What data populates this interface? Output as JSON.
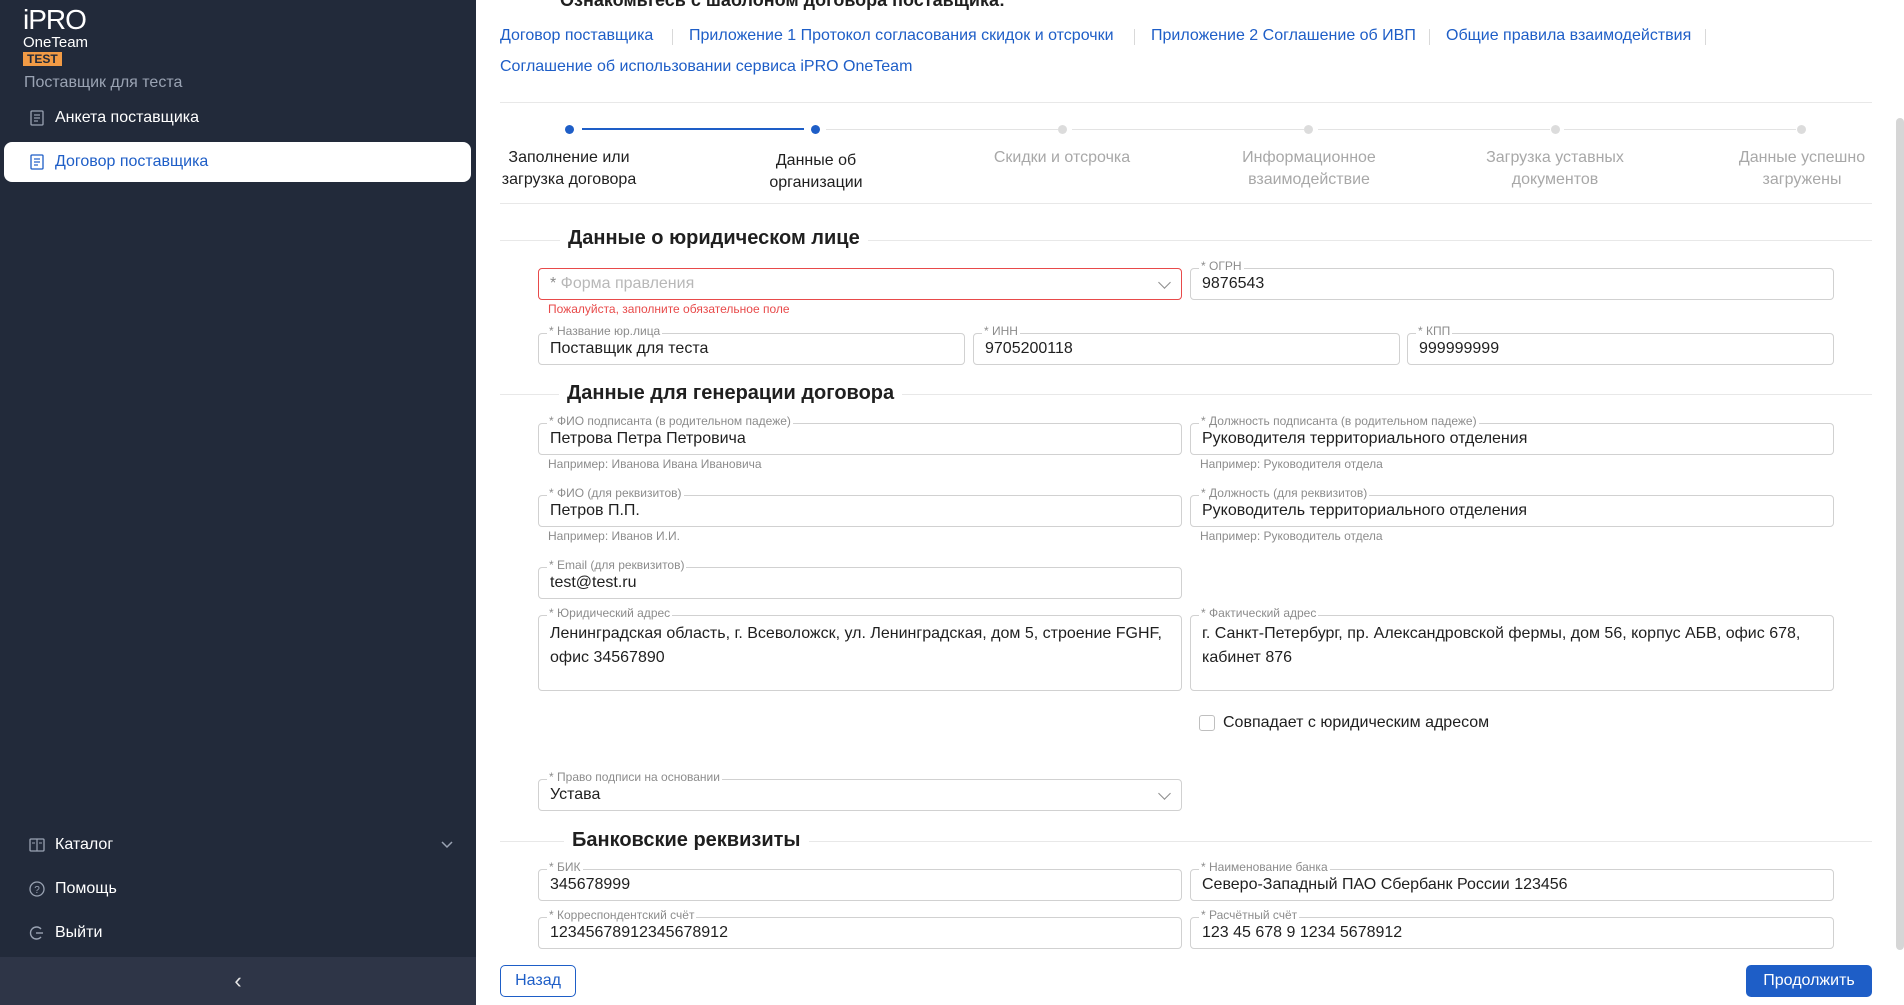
{
  "sidebar": {
    "logo_line1": "iPRO",
    "logo_line2": "OneTeam",
    "logo_badge": "TEST",
    "company": "Поставщик для теста",
    "items": [
      {
        "label": "Анкета поставщика",
        "icon": "document-icon"
      },
      {
        "label": "Договор поставщика",
        "icon": "document-icon",
        "active": true
      }
    ],
    "bottom_items": [
      {
        "label": "Каталог",
        "icon": "catalog-icon"
      },
      {
        "label": "Помощь",
        "icon": "help-icon"
      },
      {
        "label": "Выйти",
        "icon": "logout-icon"
      }
    ],
    "collapse_glyph": "‹"
  },
  "header": {
    "cut_title": "Ознакомьтесь с шаблоном договора поставщика:",
    "links": [
      "Договор поставщика",
      "Приложение 1 Протокол согласования скидок и отсрочки",
      "Приложение 2 Соглашение об ИВП",
      "Общие правила взаимодействия",
      "Соглашение об использовании сервиса iPRO OneTeam"
    ]
  },
  "steps": [
    {
      "label_1": "Заполнение или",
      "label_2": "загрузка договора",
      "state": "done"
    },
    {
      "label_1": "Данные об",
      "label_2": "организации",
      "state": "active"
    },
    {
      "label_1": "Скидки и отсрочка",
      "label_2": "",
      "state": "pending"
    },
    {
      "label_1": "Информационное",
      "label_2": "взаимодействие",
      "state": "pending"
    },
    {
      "label_1": "Загрузка уставных",
      "label_2": "документов",
      "state": "pending"
    },
    {
      "label_1": "Данные успешно",
      "label_2": "загружены",
      "state": "pending"
    }
  ],
  "legal": {
    "title": "Данные о юридическом лице",
    "form_placeholder": "Форма правления",
    "form_error": "Пожалуйста, заполните обязательное поле",
    "ogrn_label": "ОГРН",
    "ogrn_value": "9876543",
    "name_label": "Название юр.лица",
    "name_value": "Поставщик для теста",
    "inn_label": "ИНН",
    "inn_value": "9705200118",
    "kpp_label": "КПП",
    "kpp_value": "999999999"
  },
  "contract": {
    "title": "Данные для генерации договора",
    "fio_gen_label": "ФИО подписанта (в родительном падеже)",
    "fio_gen_value": "Петрова Петра Петровича",
    "fio_gen_hint": "Например: Иванова Ивана Ивановича",
    "pos_gen_label": "Должность подписанта (в родительном падеже)",
    "pos_gen_value": "Руководителя территориального отделения",
    "pos_gen_hint": "Например: Руководителя отдела",
    "fio_req_label": "ФИО (для реквизитов)",
    "fio_req_value": "Петров П.П.",
    "fio_req_hint": "Например: Иванов И.И.",
    "pos_req_label": "Должность (для реквизитов)",
    "pos_req_value": "Руководитель территориального отделения",
    "pos_req_hint": "Например: Руководитель отдела",
    "email_label": "Email (для реквизитов)",
    "email_value": "test@test.ru",
    "legal_addr_label": "Юридический адрес",
    "legal_addr_value": "Ленинградская область, г. Всеволожск, ул. Ленинградская, дом 5, строение FGHF, офис 34567890",
    "fact_addr_label": "Фактический адрес",
    "fact_addr_value": "г. Санкт-Петербург, пр. Александровской фермы, дом 56, корпус АБВ, офис 678, кабинет 876",
    "same_addr_label": "Совпадает с юридическим адресом",
    "basis_label": "Право подписи на основании",
    "basis_value": "Устава"
  },
  "bank": {
    "title": "Банковские реквизиты",
    "bik_label": "БИК",
    "bik_value": "345678999",
    "bank_name_label": "Наименование банка",
    "bank_name_value": "Северо-Западный ПАО Сбербанк России 123456",
    "corr_label": "Корреспондентский счёт",
    "corr_value": "12345678912345678912",
    "acc_label": "Расчётный счёт",
    "acc_value": "123 45 678 9 1234 5678912"
  },
  "footer": {
    "back": "Назад",
    "next": "Продолжить"
  },
  "colors": {
    "sidebar_bg": "#222a3a",
    "accent": "#1e5ec7",
    "badge": "#f29b45",
    "error": "#e84a4a"
  }
}
